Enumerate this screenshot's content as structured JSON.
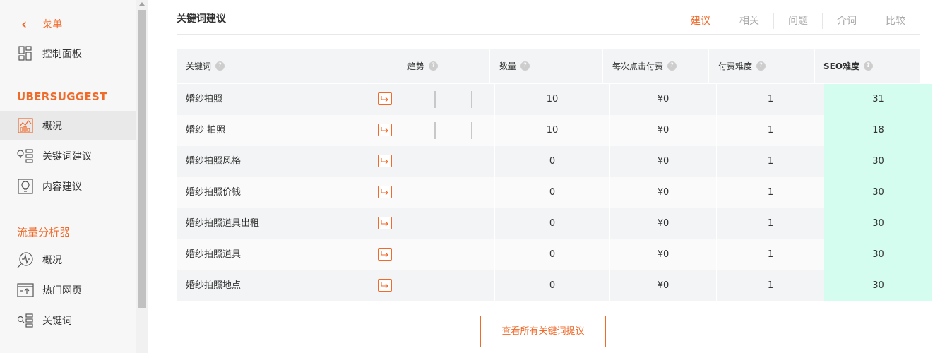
{
  "sidebar": {
    "back_label": "菜单",
    "dashboard_label": "控制面板",
    "brand": "UBERSUGGEST",
    "ubersuggest_items": [
      {
        "label": "概况",
        "icon": "chart-overview-icon"
      },
      {
        "label": "关键词建议",
        "icon": "keyword-ideas-icon"
      },
      {
        "label": "内容建议",
        "icon": "content-ideas-icon"
      }
    ],
    "traffic_section": "流量分析器",
    "traffic_items": [
      {
        "label": "概况",
        "icon": "traffic-overview-icon"
      },
      {
        "label": "热门网页",
        "icon": "top-pages-icon"
      },
      {
        "label": "关键词",
        "icon": "keywords-icon"
      }
    ]
  },
  "main": {
    "title": "关键词建议",
    "tabs": [
      {
        "label": "建议",
        "active": true
      },
      {
        "label": "相关",
        "active": false
      },
      {
        "label": "问题",
        "active": false
      },
      {
        "label": "介词",
        "active": false
      },
      {
        "label": "比较",
        "active": false
      }
    ],
    "columns": {
      "keyword": "关键词",
      "trend": "趋势",
      "volume": "数量",
      "cpc": "每次点击付费",
      "pd": "付费难度",
      "sd": "SEO难度"
    },
    "help_glyph": "?",
    "rows": [
      {
        "keyword": "婚纱拍照",
        "volume": "10",
        "cpc": "¥0",
        "pd": "1",
        "sd": "31",
        "trend": true
      },
      {
        "keyword": "婚纱 拍照",
        "volume": "10",
        "cpc": "¥0",
        "pd": "1",
        "sd": "18",
        "trend": true
      },
      {
        "keyword": "婚纱拍照风格",
        "volume": "0",
        "cpc": "¥0",
        "pd": "1",
        "sd": "30",
        "trend": false
      },
      {
        "keyword": "婚纱拍照价钱",
        "volume": "0",
        "cpc": "¥0",
        "pd": "1",
        "sd": "30",
        "trend": false
      },
      {
        "keyword": "婚纱拍照道具出租",
        "volume": "0",
        "cpc": "¥0",
        "pd": "1",
        "sd": "30",
        "trend": false
      },
      {
        "keyword": "婚纱拍照道具",
        "volume": "0",
        "cpc": "¥0",
        "pd": "1",
        "sd": "30",
        "trend": false
      },
      {
        "keyword": "婚纱拍照地点",
        "volume": "0",
        "cpc": "¥0",
        "pd": "1",
        "sd": "30",
        "trend": false
      }
    ],
    "view_all_label": "查看所有关键词提议"
  },
  "colors": {
    "accent": "#f06a2a",
    "seo_highlight": "#d4fcef",
    "active_sidebar": "#e9e9ea"
  }
}
